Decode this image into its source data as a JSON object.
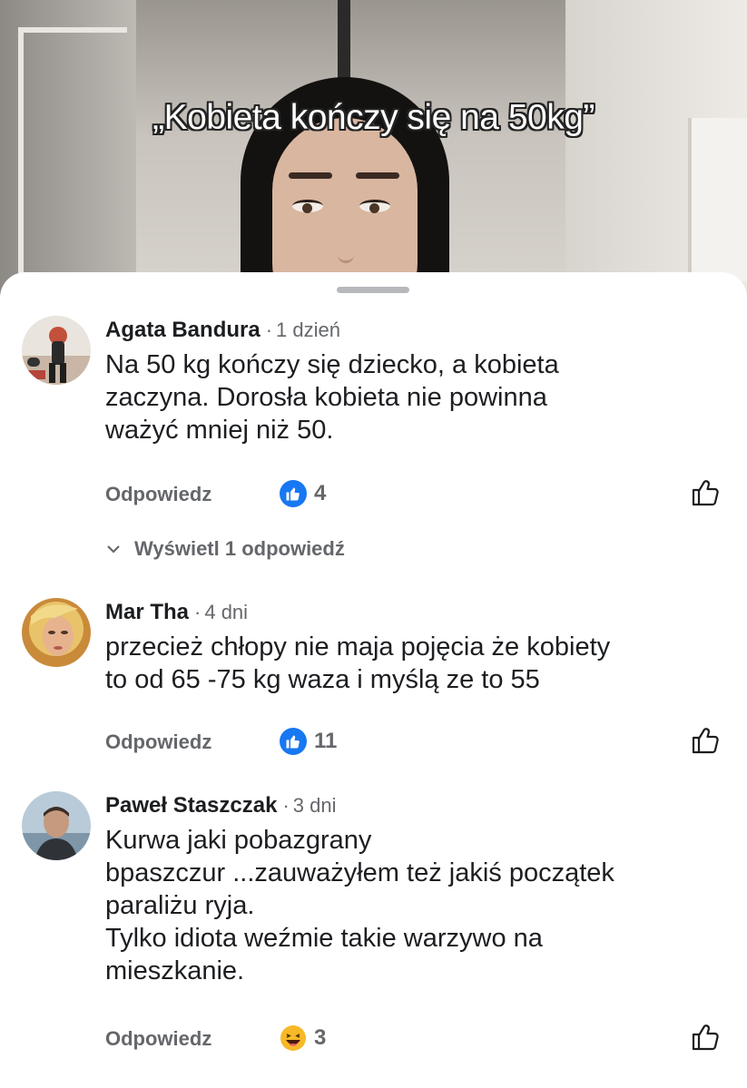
{
  "video": {
    "caption": "„Kobieta kończy się na 50kg”"
  },
  "comments": [
    {
      "author": "Agata Bandura",
      "separator": "·",
      "time": "1 dzień",
      "text": "Na 50 kg kończy się dziecko, a kobieta\nzaczyna. Dorosła kobieta nie powinna\nważyć mniej niż 50.",
      "reply_label": "Odpowiedz",
      "reaction_icon": "like-reaction-icon",
      "reaction_count": "4",
      "view_replies_label": "Wyświetl 1 odpowiedź"
    },
    {
      "author": "Mar Tha",
      "separator": "·",
      "time": "4 dni",
      "text": "przecież chłopy nie maja pojęcia że kobiety\nto od 65 -75 kg waza i myślą ze to 55",
      "reply_label": "Odpowiedz",
      "reaction_icon": "like-reaction-icon",
      "reaction_count": "11"
    },
    {
      "author": "Paweł Staszczak",
      "separator": "·",
      "time": "3 dni",
      "text": "Kurwa jaki pobazgrany\nbpaszczur ...zauważyłem też jakiś początek\nparaliżu ryja.\nTylko idiota weźmie takie warzywo na\nmieszkanie.",
      "reply_label": "Odpowiedz",
      "reaction_icon": "haha-reaction-icon",
      "reaction_count": "3"
    }
  ],
  "colors": {
    "like_blue": "#1877f2",
    "haha_yellow": "#f7b928",
    "secondary_text": "#65676b",
    "primary_text": "#1c1e21"
  }
}
